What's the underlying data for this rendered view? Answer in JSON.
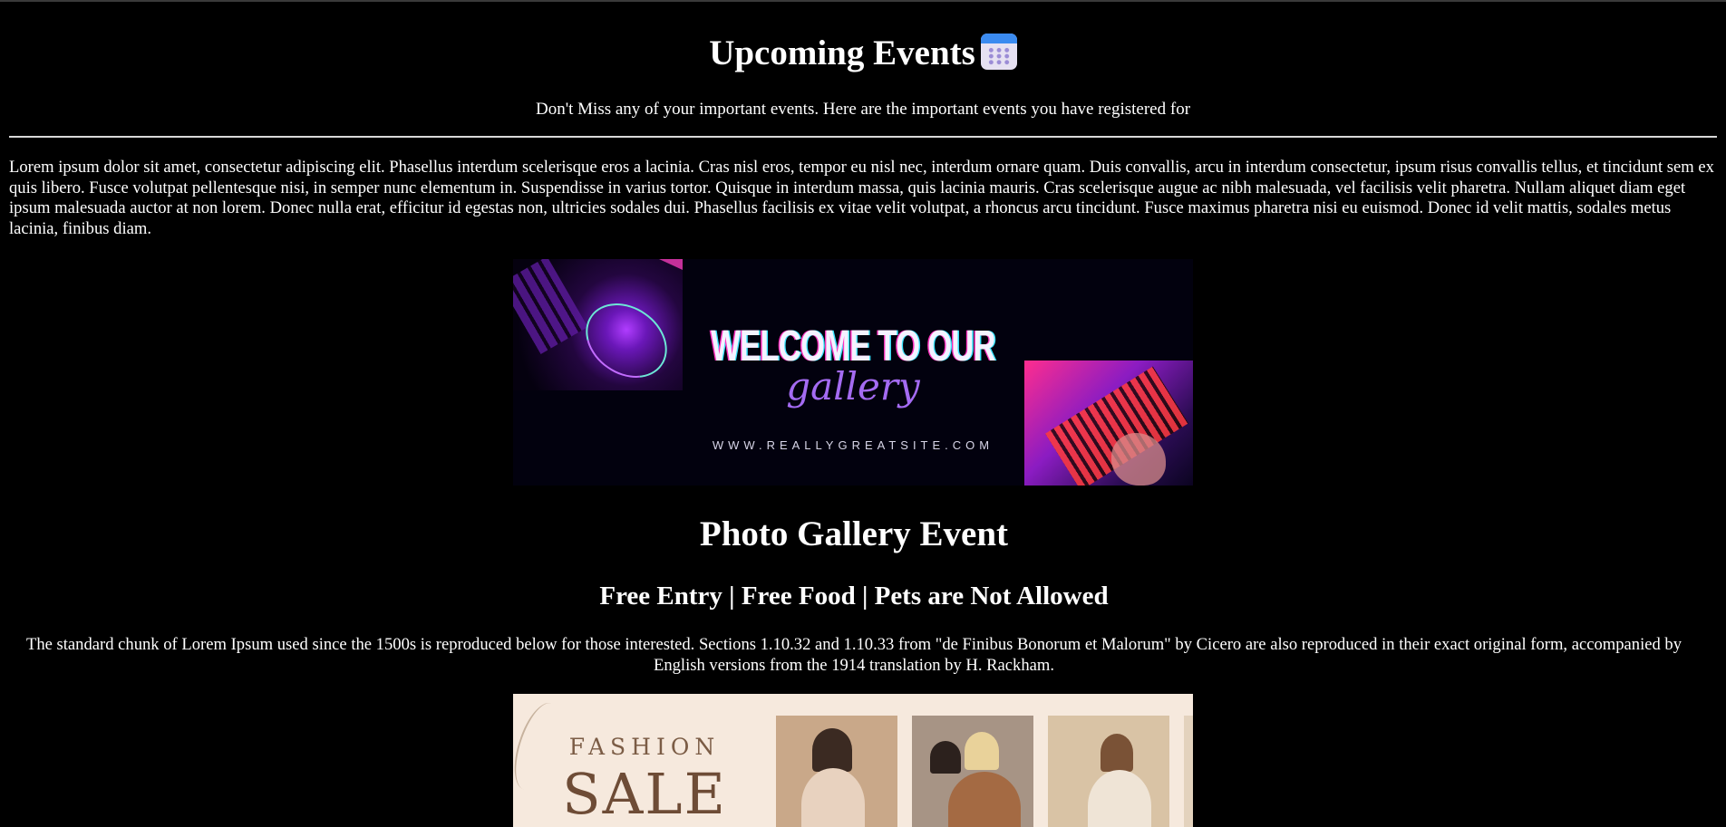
{
  "header": {
    "title": "Upcoming Events",
    "title_icon": "calendar-icon",
    "subtitle": "Don't Miss any of your important events. Here are the important events you have registered for"
  },
  "intro": {
    "text": "Lorem ipsum dolor sit amet, consectetur adipiscing elit. Phasellus interdum scelerisque eros a lacinia. Cras nisl eros, tempor eu nisl nec, interdum ornare quam. Duis convallis, arcu in interdum consectetur, ipsum risus convallis tellus, et tincidunt sem ex quis libero. Fusce volutpat pellentesque nisi, in semper nunc elementum in. Suspendisse in varius tortor. Quisque in interdum massa, quis lacinia mauris. Cras scelerisque augue ac nibh malesuada, vel facilisis velit pharetra. Nullam aliquet diam eget ipsum malesuada auctor at non lorem. Donec nulla erat, efficitur id egestas non, ultricies sodales dui. Phasellus facilisis ex vitae velit volutpat, a rhoncus arcu tincidunt. Fusce maximus pharetra nisi eu euismod. Donec id velit mattis, sodales metus lacinia, finibus diam."
  },
  "events": [
    {
      "banner": {
        "line1": "WELCOME TO OUR",
        "line2": "gallery",
        "site": "WWW.REALLYGREATSITE.COM"
      },
      "title": "Photo Gallery Event",
      "tags": "Free Entry | Free Food | Pets are Not Allowed",
      "description": "The standard chunk of Lorem Ipsum used since the 1500s is reproduced below for those interested. Sections 1.10.32 and 1.10.33 from \"de Finibus Bonorum et Malorum\" by Cicero are also reproduced in their exact original form, accompanied by English versions from the 1914 translation by H. Rackham."
    },
    {
      "banner": {
        "line1": "FASHION",
        "line2": "SALE"
      }
    }
  ],
  "colors": {
    "background": "#000000",
    "text": "#ffffff",
    "banner_accent": "#a46bf2",
    "fashion_bg": "#f6e9dd"
  }
}
